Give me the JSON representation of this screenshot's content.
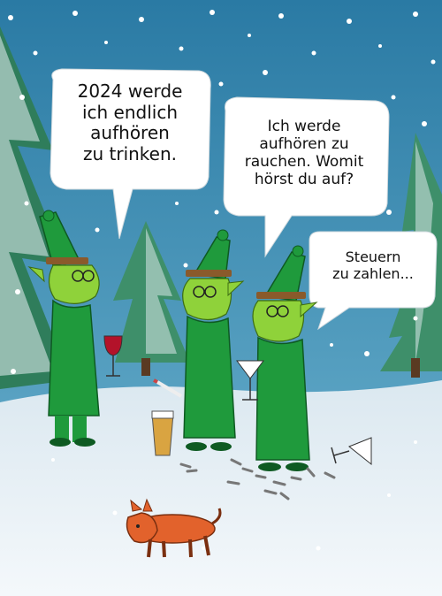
{
  "bubbles": {
    "elf_left": "2024 werde\nich endlich\naufhören\nzu trinken.",
    "elf_middle": "Ich werde\naufhören zu\nrauchen. Womit\nhörst du auf?",
    "elf_right": "Steuern\nzu zahlen..."
  },
  "colors": {
    "sky": "#2f86ad",
    "snow": "#e9f1f6",
    "elf_green": "#1f9a3c",
    "elf_skin": "#8fd23a",
    "dog": "#e2622c",
    "wine": "#b3122a",
    "beer": "#d9a441"
  }
}
